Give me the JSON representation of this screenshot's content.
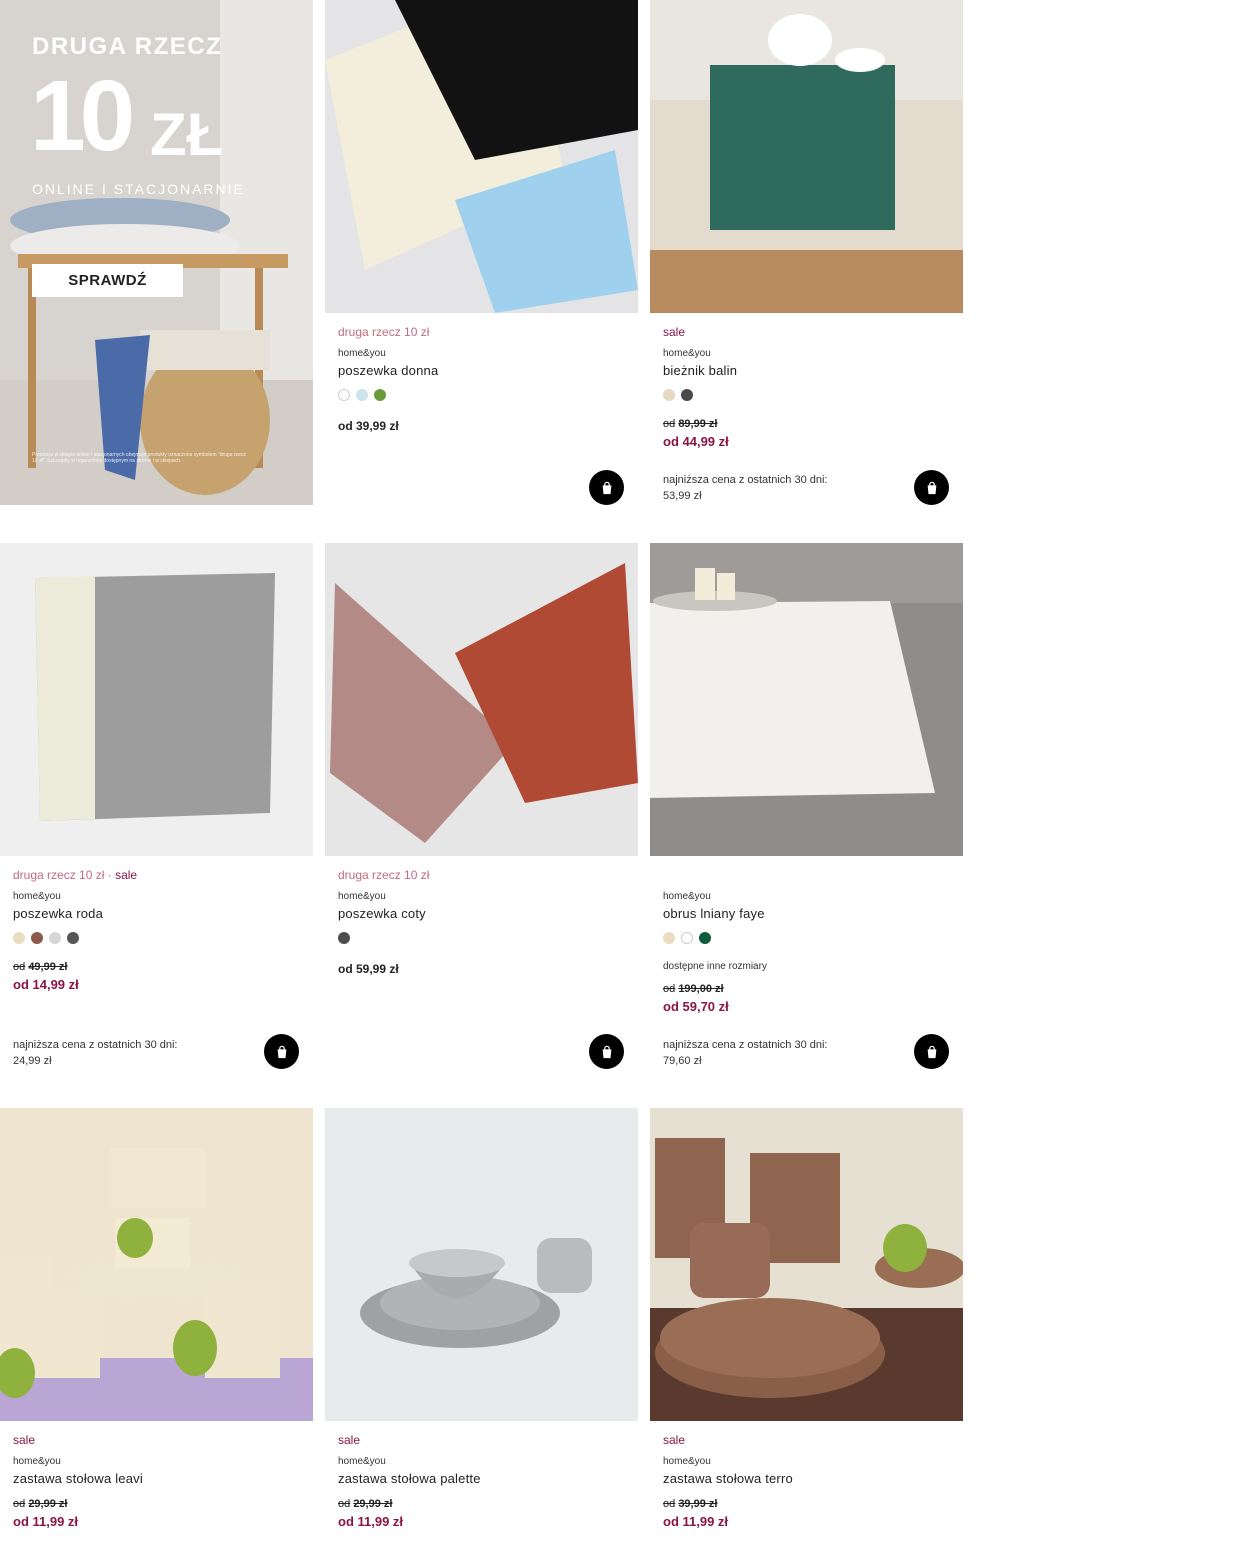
{
  "banner": {
    "title": "DRUGA RZECZ",
    "amount": "10",
    "currency": "ZŁ",
    "subtitle": "ONLINE I STACJONARNIE",
    "cta": "SPRAWDŹ",
    "legal": "Promocja w sklepie online i stacjonarnych obejmuje produkty oznaczone symbolem \"druga rzecz 10 zł\". Szczegóły w regulaminie dostępnym na stronie i w sklepach."
  },
  "products": [
    {
      "promo": "druga rzecz 10 zł",
      "brand": "home&you",
      "name": "poszewka donna",
      "swatches": [
        "#ffffff",
        "#cde4ee",
        "#6a9a3a"
      ],
      "price": "od 39,99 zł"
    },
    {
      "sale": "sale",
      "brand": "home&you",
      "name": "bieżnik balin",
      "swatches": [
        "#e6d9c0",
        "#4a4a4a"
      ],
      "old_prefix": "od",
      "old_price": "89,99 zł",
      "new_price": "od 44,99 zł",
      "lowest_label": "najniższa cena z ostatnich 30 dni:",
      "lowest_value": "53,99 zł"
    },
    {
      "promo": "druga rzecz 10 zł",
      "promo_sep": " · ",
      "sale": "sale",
      "brand": "home&you",
      "name": "poszewka roda",
      "swatches": [
        "#e9dcc1",
        "#8a5a4a",
        "#d6d6d6",
        "#555555"
      ],
      "old_prefix": "od",
      "old_price": "49,99 zł",
      "new_price": "od 14,99 zł",
      "lowest_label": "najniższa cena z ostatnich 30 dni:",
      "lowest_value": "24,99 zł"
    },
    {
      "promo": "druga rzecz 10 zł",
      "brand": "home&you",
      "name": "poszewka coty",
      "swatches": [
        "#4d4d4d"
      ],
      "price": "od 59,99 zł"
    },
    {
      "brand": "home&you",
      "name": "obrus lniany faye",
      "swatches": [
        "#e9dcc1",
        "#ffffff",
        "#0f5a3c"
      ],
      "note": "dostępne inne rozmiary",
      "old_prefix": "od",
      "old_price": "199,00 zł",
      "new_price": "od 59,70 zł",
      "lowest_label": "najniższa cena z ostatnich 30 dni:",
      "lowest_value": "79,60 zł"
    },
    {
      "sale": "sale",
      "brand": "home&you",
      "name": "zastawa stołowa leavi",
      "old_prefix": "od",
      "old_price": "29,99 zł",
      "new_price": "od 11,99 zł"
    },
    {
      "sale": "sale",
      "brand": "home&you",
      "name": "zastawa stołowa palette",
      "old_prefix": "od",
      "old_price": "29,99 zł",
      "new_price": "od 11,99 zł"
    },
    {
      "sale": "sale",
      "brand": "home&you",
      "name": "zastawa stołowa terro",
      "old_prefix": "od",
      "old_price": "39,99 zł",
      "new_price": "od 11,99 zł"
    }
  ],
  "icons": {
    "cart": "shopping-bag-icon"
  },
  "colors": {
    "sale": "#8a1446",
    "promo": "#c06b80",
    "cart_button": "#000000"
  }
}
